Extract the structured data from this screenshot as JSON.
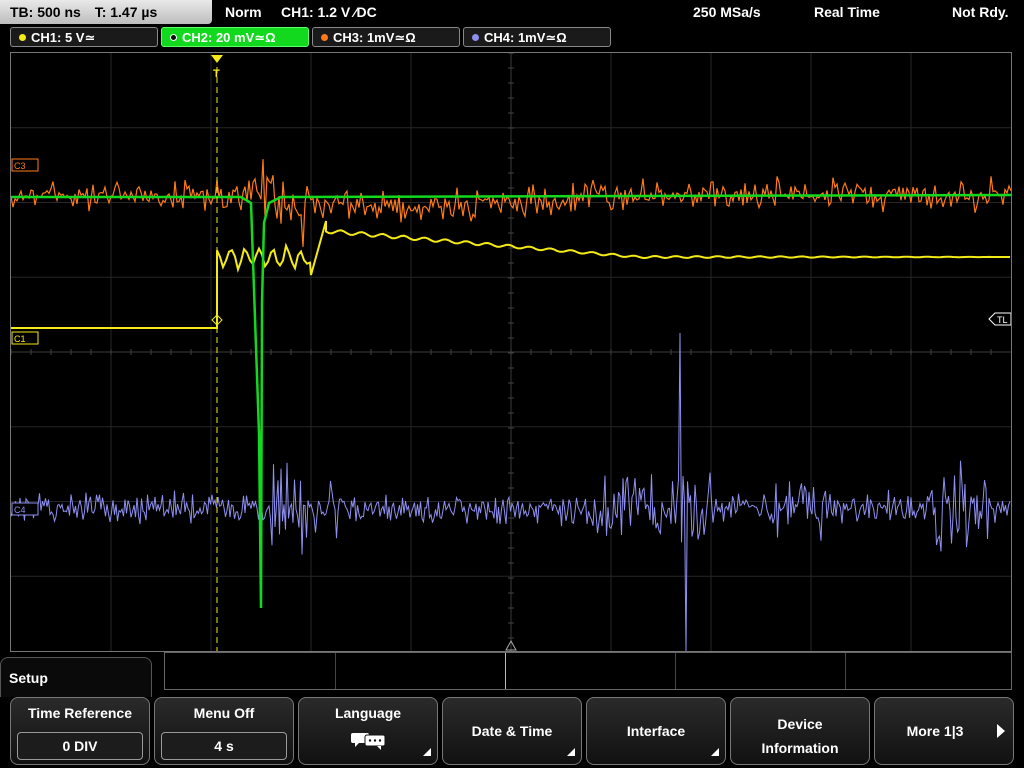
{
  "status": {
    "timebase": "TB: 500 ns",
    "trigger_pos": "T: 1.47 µs",
    "mode": "Norm",
    "trigger_info": "CH1: 1.2 V ⁄DC",
    "sample_rate": "250 MSa/s",
    "acq_mode": "Real Time",
    "state": "Not Rdy."
  },
  "channels": [
    {
      "label": "CH1: 5 V≃",
      "color": "#f4ea16"
    },
    {
      "label": "CH2: 20 mV≃Ω",
      "color": "#12d81e"
    },
    {
      "label": "CH3: 1mV≃Ω",
      "color": "#ff7a1a"
    },
    {
      "label": "CH4: 1mV≃Ω",
      "color": "#8f8ff0"
    }
  ],
  "markers": {
    "c3": "C3",
    "c1": "C1",
    "tl": "TL",
    "c4": "C4",
    "trigger": "T"
  },
  "menu": {
    "title": "Setup",
    "keys": [
      {
        "label": "Time Reference",
        "value": "0 DIV"
      },
      {
        "label": "Menu Off",
        "value": "4 s"
      },
      {
        "label": "Language"
      },
      {
        "label": "Date & Time"
      },
      {
        "label": "Interface"
      },
      {
        "label_line1": "Device",
        "label_line2": "Information"
      },
      {
        "label": "More 1|3"
      }
    ]
  },
  "icons": {
    "language": "speech-bubbles-icon",
    "submenu": "corner-triangle-icon",
    "next": "right-arrow-icon"
  }
}
